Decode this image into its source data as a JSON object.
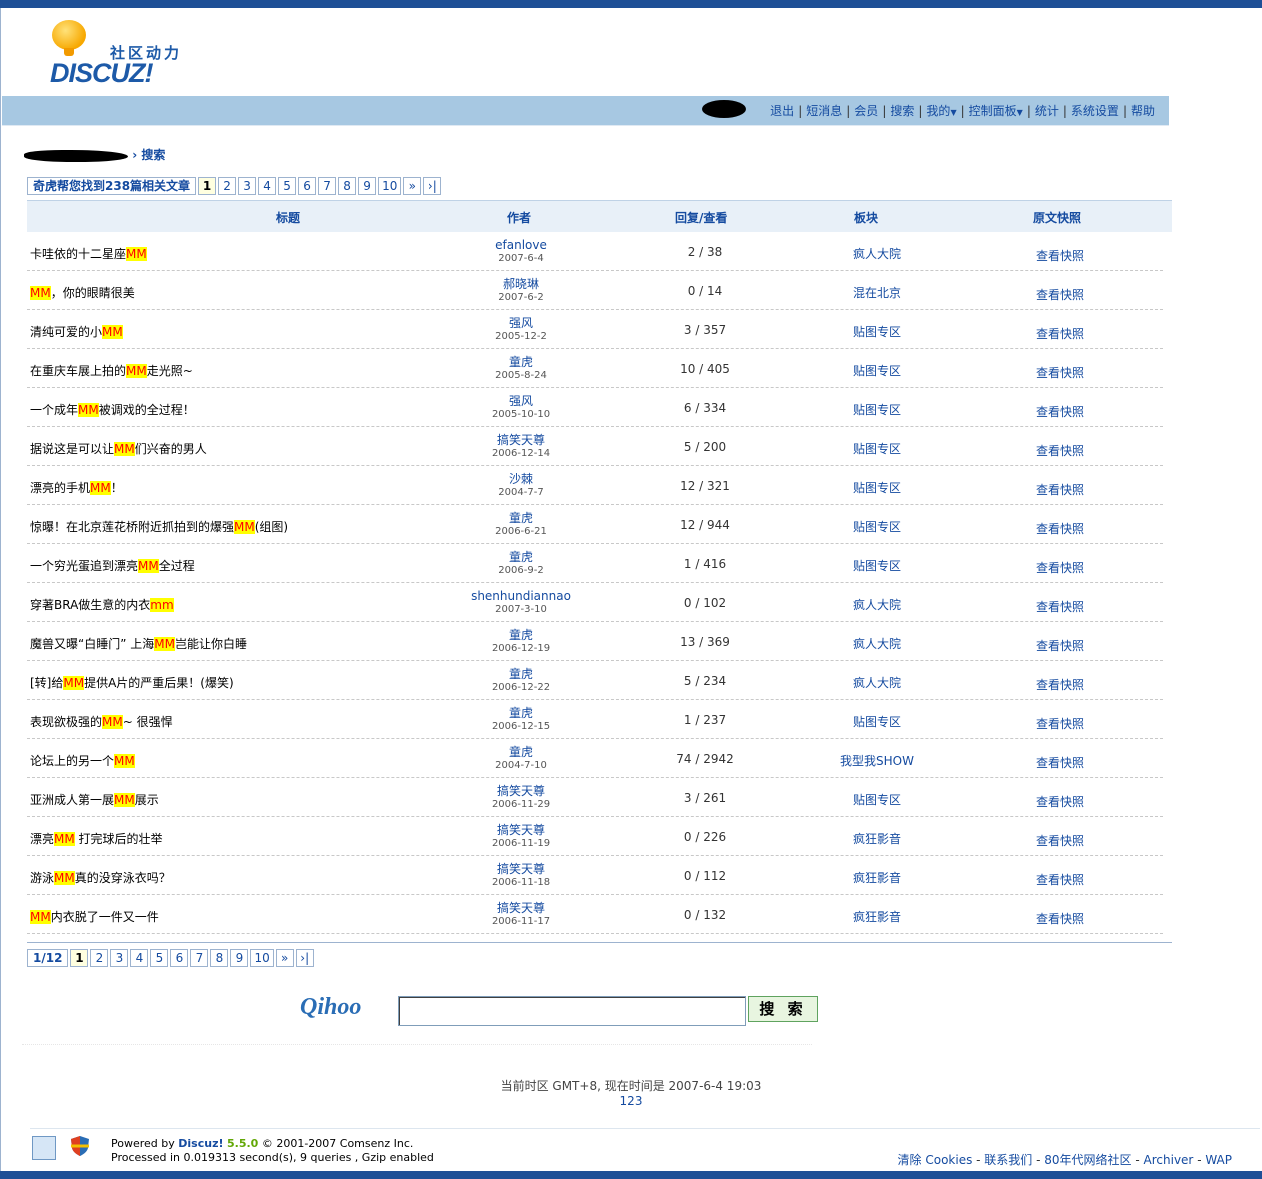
{
  "logo": {
    "sub": "社区动力",
    "main": "DISCUZ!"
  },
  "nav": {
    "items": [
      "退出",
      "短消息",
      "会员",
      "搜索",
      "我的",
      "控制面板",
      "统计",
      "系统设置",
      "帮助"
    ]
  },
  "breadcrumb": {
    "current": "搜索"
  },
  "result_summary": "奇虎帮您找到238篇相关文章",
  "pager_top": {
    "pages": [
      "1",
      "2",
      "3",
      "4",
      "5",
      "6",
      "7",
      "8",
      "9",
      "10"
    ],
    "next": "»",
    "last": "›|"
  },
  "table": {
    "headers": {
      "title": "标题",
      "author": "作者",
      "stats": "回复/查看",
      "forum": "板块",
      "snapshot": "原文快照"
    },
    "rows": [
      {
        "pre": "卡哇依的十二星座",
        "kw": "MM",
        "post": "",
        "author": "efanlove",
        "date": "2007-6-4",
        "stats": "2 / 38",
        "forum": "疯人大院",
        "snap": "查看快照"
      },
      {
        "pre": "",
        "kw": "MM",
        "post": "，你的眼睛很美",
        "author": "郝晓琳",
        "date": "2007-6-2",
        "stats": "0 / 14",
        "forum": "混在北京",
        "snap": "查看快照"
      },
      {
        "pre": "清纯可爱的小",
        "kw": "MM",
        "post": "",
        "author": "强风",
        "date": "2005-12-2",
        "stats": "3 / 357",
        "forum": "贴图专区",
        "snap": "查看快照"
      },
      {
        "pre": "在重庆车展上拍的",
        "kw": "MM",
        "post": "走光照~",
        "author": "童虎",
        "date": "2005-8-24",
        "stats": "10 / 405",
        "forum": "贴图专区",
        "snap": "查看快照"
      },
      {
        "pre": "一个成年",
        "kw": "MM",
        "post": "被调戏的全过程！",
        "author": "强风",
        "date": "2005-10-10",
        "stats": "6 / 334",
        "forum": "贴图专区",
        "snap": "查看快照"
      },
      {
        "pre": "据说这是可以让",
        "kw": "MM",
        "post": "们兴奋的男人",
        "author": "搞笑天尊",
        "date": "2006-12-14",
        "stats": "5 / 200",
        "forum": "贴图专区",
        "snap": "查看快照"
      },
      {
        "pre": "漂亮的手机",
        "kw": "MM",
        "post": "！",
        "author": "沙棘",
        "date": "2004-7-7",
        "stats": "12 / 321",
        "forum": "贴图专区",
        "snap": "查看快照"
      },
      {
        "pre": "惊曝！在北京莲花桥附近抓拍到的爆强",
        "kw": "MM",
        "post": "(组图)",
        "author": "童虎",
        "date": "2006-6-21",
        "stats": "12 / 944",
        "forum": "贴图专区",
        "snap": "查看快照"
      },
      {
        "pre": "一个穷光蛋追到漂亮",
        "kw": "MM",
        "post": "全过程",
        "author": "童虎",
        "date": "2006-9-2",
        "stats": "1 / 416",
        "forum": "贴图专区",
        "snap": "查看快照"
      },
      {
        "pre": "穿著BRA做生意的内衣",
        "kw": "mm",
        "post": "",
        "author": "shenhundiannao",
        "date": "2007-3-10",
        "stats": "0 / 102",
        "forum": "疯人大院",
        "snap": "查看快照"
      },
      {
        "pre": "魔兽又曝“白睡门” 上海",
        "kw": "MM",
        "post": "岂能让你白睡",
        "author": "童虎",
        "date": "2006-12-19",
        "stats": "13 / 369",
        "forum": "疯人大院",
        "snap": "查看快照"
      },
      {
        "pre": "[转]给",
        "kw": "MM",
        "post": "提供A片的严重后果！(爆笑)",
        "author": "童虎",
        "date": "2006-12-22",
        "stats": "5 / 234",
        "forum": "疯人大院",
        "snap": "查看快照"
      },
      {
        "pre": "表现欲极强的",
        "kw": "MM",
        "post": "~ 很强悍",
        "author": "童虎",
        "date": "2006-12-15",
        "stats": "1 / 237",
        "forum": "贴图专区",
        "snap": "查看快照"
      },
      {
        "pre": "论坛上的另一个",
        "kw": "MM",
        "post": "",
        "author": "童虎",
        "date": "2004-7-10",
        "stats": "74 / 2942",
        "forum": "我型我SHOW",
        "snap": "查看快照"
      },
      {
        "pre": "亚洲成人第一展",
        "kw": "MM",
        "post": "展示",
        "author": "搞笑天尊",
        "date": "2006-11-29",
        "stats": "3 / 261",
        "forum": "贴图专区",
        "snap": "查看快照"
      },
      {
        "pre": "漂亮",
        "kw": "MM",
        "post": " 打完球后的壮举",
        "author": "搞笑天尊",
        "date": "2006-11-19",
        "stats": "0 / 226",
        "forum": "疯狂影音",
        "snap": "查看快照"
      },
      {
        "pre": "游泳",
        "kw": "MM",
        "post": "真的没穿泳衣吗？",
        "author": "搞笑天尊",
        "date": "2006-11-18",
        "stats": "0 / 112",
        "forum": "疯狂影音",
        "snap": "查看快照"
      },
      {
        "pre": "",
        "kw": "MM",
        "post": "内衣脱了一件又一件",
        "author": "搞笑天尊",
        "date": "2006-11-17",
        "stats": "0 / 132",
        "forum": "疯狂影音",
        "snap": "查看快照"
      }
    ]
  },
  "pager_bottom": {
    "label": "1/12",
    "pages": [
      "1",
      "2",
      "3",
      "4",
      "5",
      "6",
      "7",
      "8",
      "9",
      "10"
    ],
    "next": "»",
    "last": "›|"
  },
  "search": {
    "logo": "Qihoo",
    "button": "搜 索",
    "value": ""
  },
  "footer": {
    "timezone": "当前时区 GMT+8, 现在时间是 2007-6-4 19:03",
    "number": "123",
    "powered_prefix": "Powered by ",
    "powered_name": "Discuz!",
    "powered_version": "5.5.0",
    "powered_suffix": " © 2001-2007 Comsenz Inc.",
    "processed": "Processed in 0.019313 second(s), 9 queries , Gzip enabled",
    "links": [
      "清除 Cookies",
      "联系我们",
      "80年代网络社区",
      "Archiver",
      "WAP"
    ]
  },
  "colors": {
    "brand": "#1e4f96",
    "nav_bg": "#a7c8e2",
    "link": "#154ba0",
    "highlight_bg": "#ffff00",
    "highlight_text": "#ff0000"
  }
}
